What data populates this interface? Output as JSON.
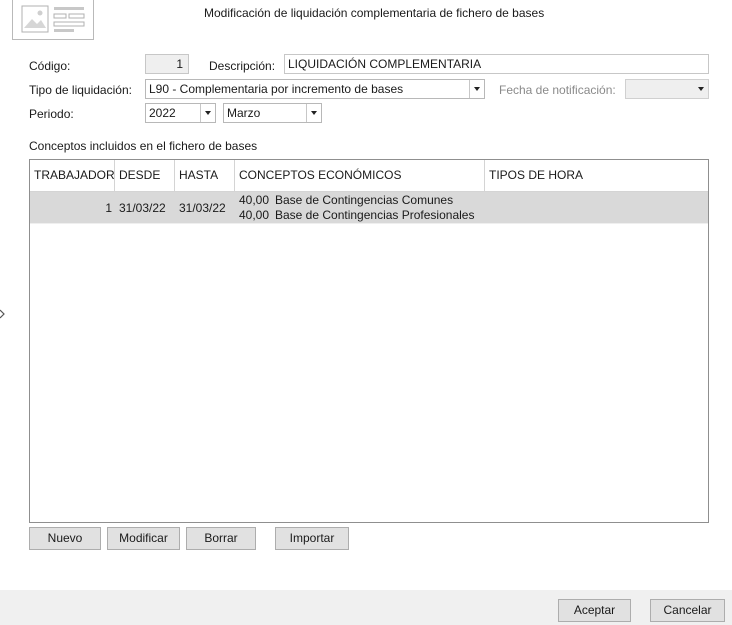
{
  "window": {
    "title": "Modificación de liquidación complementaria de fichero de bases"
  },
  "form": {
    "codigo_label": "Código:",
    "codigo_value": "1",
    "descripcion_label": "Descripción:",
    "descripcion_value": "LIQUIDACIÓN COMPLEMENTARIA",
    "tipo_label": "Tipo de liquidación:",
    "tipo_value": "L90 - Complementaria por incremento de bases",
    "fecha_label": "Fecha de notificación:",
    "fecha_value": "",
    "periodo_label": "Periodo:",
    "periodo_year": "2022",
    "periodo_month": "Marzo"
  },
  "section": {
    "title": "Conceptos incluidos en el fichero de bases"
  },
  "table": {
    "columns": [
      "TRABAJADOR",
      "DESDE",
      "HASTA",
      "CONCEPTOS ECONÓMICOS",
      "TIPOS DE HORA"
    ],
    "rows": [
      {
        "trabajador": "1",
        "desde": "31/03/22",
        "hasta": "31/03/22",
        "conceptos": [
          {
            "amount": "40,00",
            "name": "Base de Contingencias Comunes"
          },
          {
            "amount": "40,00",
            "name": "Base de Contingencias Profesionales"
          }
        ],
        "tipos_hora": ""
      }
    ]
  },
  "buttons": {
    "nuevo": "Nuevo",
    "modificar": "Modificar",
    "borrar": "Borrar",
    "importar": "Importar",
    "aceptar": "Aceptar",
    "cancelar": "Cancelar"
  },
  "colors": {
    "selected_row": "#d9d9d9",
    "footer_bg": "#f0f0f0",
    "button_bg": "#e1e1e1"
  }
}
